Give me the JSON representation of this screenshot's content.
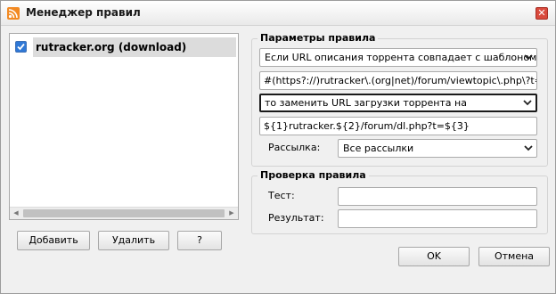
{
  "window": {
    "title": "Менеджер правил"
  },
  "rules": {
    "items": [
      {
        "label": "rutracker.org (download)",
        "checked": true
      }
    ]
  },
  "left_buttons": {
    "add": "Добавить",
    "delete": "Удалить",
    "help": "?"
  },
  "params": {
    "title": "Параметры правила",
    "condition_select": "Если URL описания торрента совпадает с шаблоном",
    "pattern_value": "#(https?://)rutracker\\.(org|net)/forum/viewtopic\\.php\\?t=(\\d+)#",
    "action_select": "то заменить URL загрузки торрента на",
    "replacement_value": "${1}rutracker.${2}/forum/dl.php?t=${3}",
    "mailing_label": "Рассылка:",
    "mailing_select": "Все рассылки"
  },
  "check": {
    "title": "Проверка правила",
    "test_label": "Тест:",
    "test_value": "",
    "result_label": "Результат:",
    "result_value": ""
  },
  "dialog_buttons": {
    "ok": "OK",
    "cancel": "Отмена"
  },
  "colors": {
    "window_bg": "#f0f0f0",
    "app_icon": "#f28a23",
    "close_button": "#d94a3d",
    "checkbox": "#2f78d6",
    "selected_row": "#dcdcdc"
  }
}
